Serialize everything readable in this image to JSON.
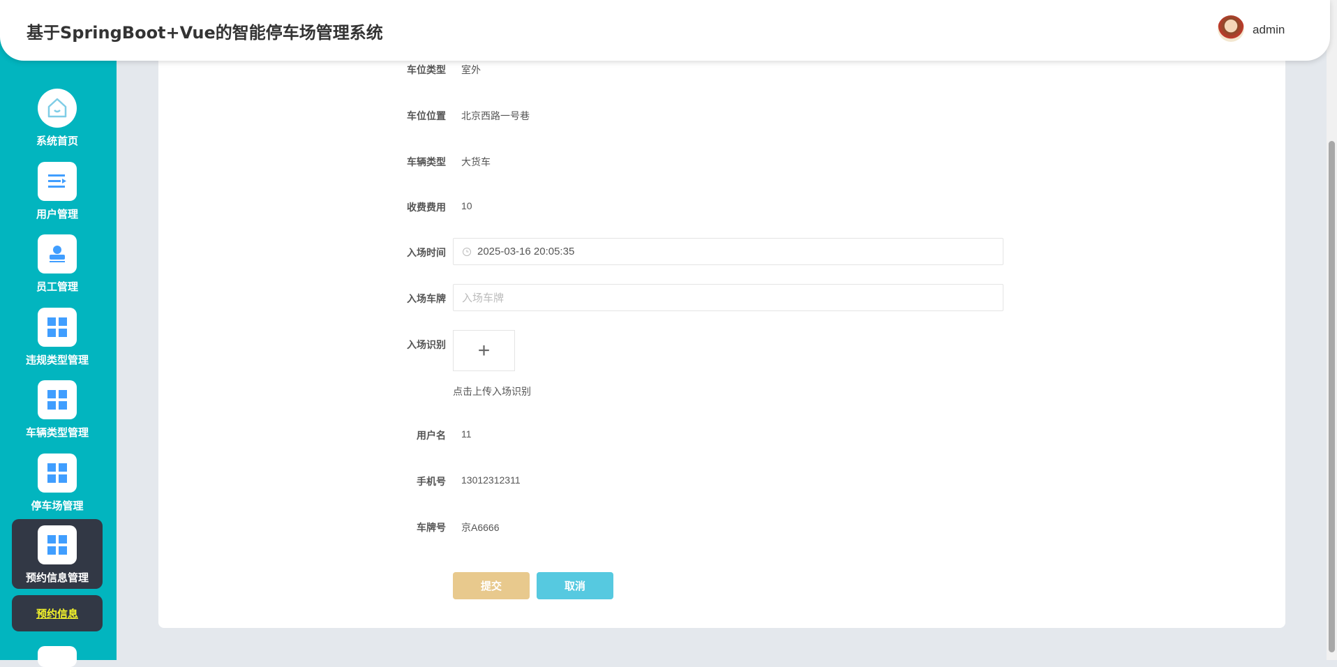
{
  "header": {
    "title": "基于SpringBoot+Vue的智能停车场管理系统",
    "username": "admin"
  },
  "sidebar": {
    "items": [
      {
        "label": "系统首页",
        "icon": "home-icon"
      },
      {
        "label": "用户管理",
        "icon": "list-icon"
      },
      {
        "label": "员工管理",
        "icon": "user-icon"
      },
      {
        "label": "违规类型管理",
        "icon": "grid-icon"
      },
      {
        "label": "车辆类型管理",
        "icon": "grid-icon"
      },
      {
        "label": "停车场管理",
        "icon": "grid-icon"
      },
      {
        "label": "预约信息管理",
        "icon": "grid-icon",
        "active": true
      }
    ],
    "submenu": {
      "label": "预约信息"
    }
  },
  "form": {
    "fields": [
      {
        "label": "车位类型",
        "value": "室外"
      },
      {
        "label": "车位位置",
        "value": "北京西路一号巷"
      },
      {
        "label": "车辆类型",
        "value": "大货车"
      },
      {
        "label": "收费费用",
        "value": "10"
      }
    ],
    "entry_time": {
      "label": "入场时间",
      "value": "2025-03-16 20:05:35"
    },
    "entry_plate": {
      "label": "入场车牌",
      "placeholder": "入场车牌"
    },
    "entry_recognition": {
      "label": "入场识别",
      "hint": "点击上传入场识别"
    },
    "fields2": [
      {
        "label": "用户名",
        "value": "11"
      },
      {
        "label": "手机号",
        "value": "13012312311"
      },
      {
        "label": "车牌号",
        "value": "京A6666"
      }
    ],
    "submit": "提交",
    "cancel": "取消"
  },
  "colors": {
    "sidebar": "#02b5bf",
    "active": "#323845",
    "submit": "#e8c98d",
    "cancel": "#56c9e0",
    "icon": "#409eff"
  }
}
